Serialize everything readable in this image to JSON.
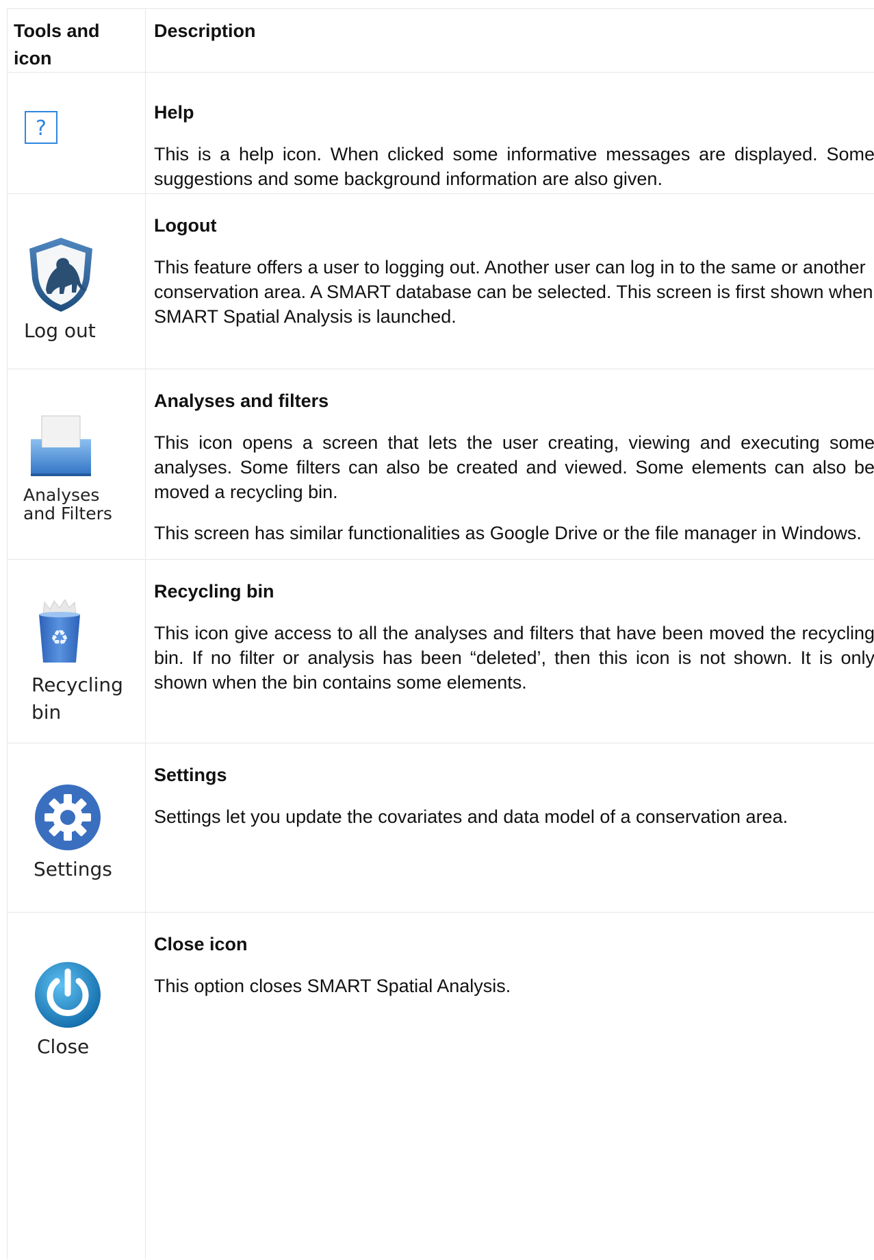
{
  "header": {
    "col1": "Tools and icon",
    "col2": "Description"
  },
  "rows": [
    {
      "icon": "help-icon",
      "icon_label": "",
      "title": "Help",
      "paragraphs": [
        "This is a help icon. When clicked some informative messages are displayed. Some suggestions and some background information  are also given."
      ]
    },
    {
      "icon": "logout-shield-icon",
      "icon_label": "Log out",
      "title": "Logout",
      "paragraphs": [
        "This feature offers a user to logging out. Another user can log in to the same or another conservation area.  A SMART database can be selected. This screen is first shown when SMART Spatial Analysis is launched."
      ]
    },
    {
      "icon": "analyses-filters-tray-icon",
      "icon_label_line1": "Analyses",
      "icon_label_line2": "and Filters",
      "title": "Analyses and filters",
      "paragraphs": [
        "This icon opens a screen that lets the user creating, viewing and executing some analyses. Some filters can also be created and viewed.  Some elements can also be moved a recycling bin.",
        "This screen has similar functionalities as Google Drive or the file manager in Windows."
      ]
    },
    {
      "icon": "recycling-bin-icon",
      "icon_label_line1": "Recycling",
      "icon_label_line2": "bin",
      "title": "Recycling bin",
      "paragraphs": [
        "This icon give access to all the analyses and filters that have been moved the recycling bin. If no filter or analysis has been “deleted’, then this icon is not shown.  It is only shown when the bin contains some elements."
      ]
    },
    {
      "icon": "gear-icon",
      "icon_label": "Settings",
      "title": "Settings",
      "paragraphs": [
        "Settings let you update the covariates and data model of a conservation area."
      ]
    },
    {
      "icon": "power-icon",
      "icon_label": "Close",
      "title": "Close icon",
      "paragraphs": [
        "This option closes SMART Spatial Analysis."
      ]
    }
  ],
  "colors": {
    "border": "#e6e6e6",
    "help_blue": "#2e86de",
    "shield_blue": "#2f5f8f",
    "tray_blue": "#4a8fdc",
    "gear_blue": "#3a6fc0",
    "power_blue": "#1e88c8"
  }
}
